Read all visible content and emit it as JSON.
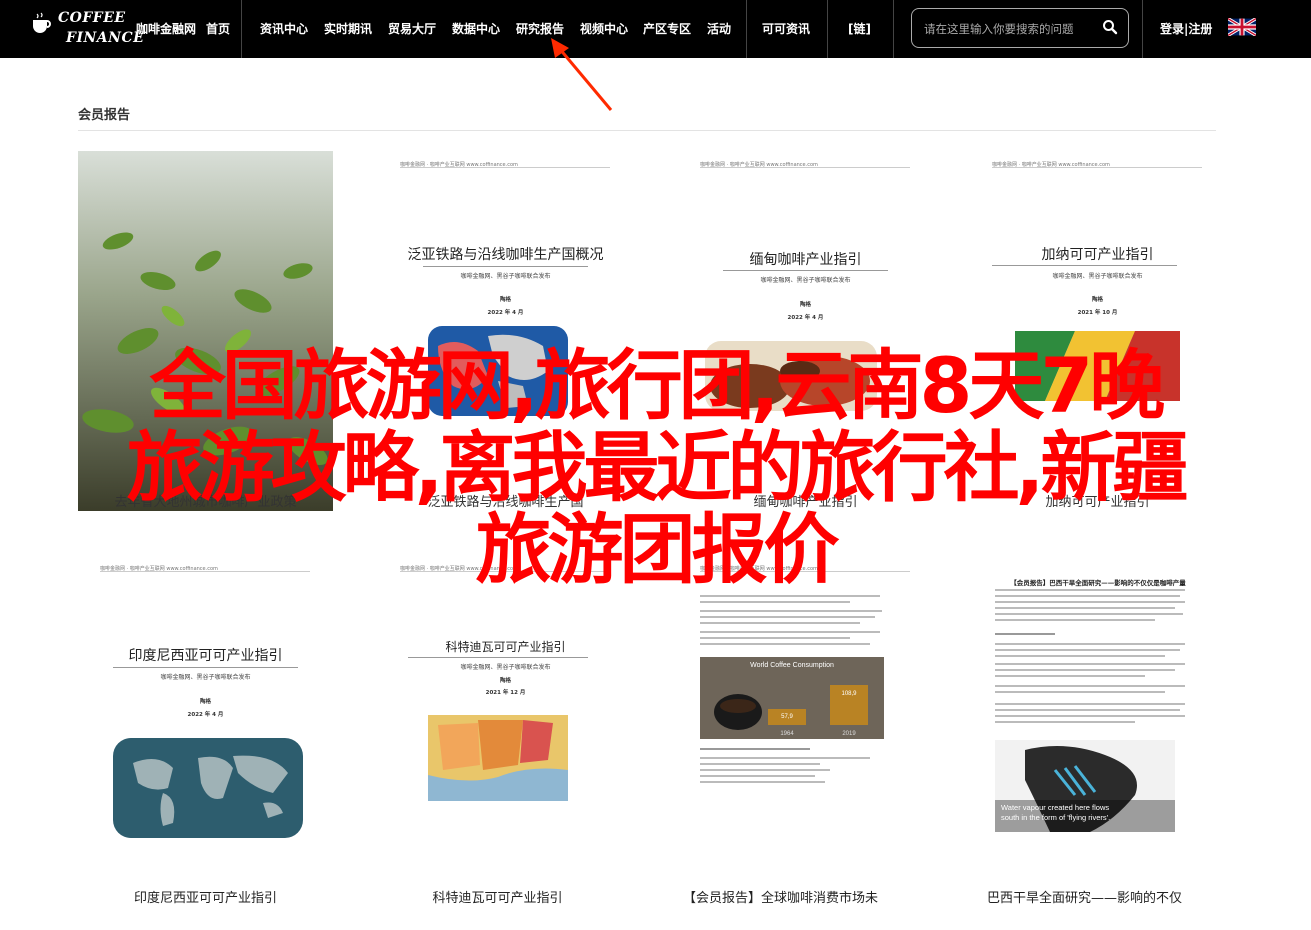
{
  "nav": {
    "logo_line1": "COFFEE",
    "logo_line2": "FINANCE",
    "items": [
      "咖啡金融网",
      "首页",
      "资讯中心",
      "实时期讯",
      "贸易大厅",
      "数据中心",
      "研究报告",
      "视频中心",
      "产区专区",
      "活动",
      "可可资讯",
      "[链]"
    ],
    "search_placeholder": "请在这里输入你要搜索的问题",
    "login": "登录|注册"
  },
  "section": {
    "title": "会员报告"
  },
  "cards": [
    {
      "doc_title": "",
      "caption": ""
    },
    {
      "doc_title": "泛亚铁路与沿线咖啡生产国概况",
      "doc_sub": "咖啡金融网、黑谷子咖啡联合发布",
      "doc_small1": "陶格",
      "doc_small2": "2022 年 4 月",
      "doc_header": "咖啡金融网 · 咖啡产业互联网 www.coffinance.com",
      "caption": ""
    },
    {
      "doc_title": "缅甸咖啡产业指引",
      "doc_sub": "咖啡金融网、黑谷子咖啡联合发布",
      "doc_small1": "陶格",
      "doc_small2": "2022 年 4 月",
      "doc_header": "咖啡金融网 · 咖啡产业互联网 www.coffinance.com",
      "caption": ""
    },
    {
      "doc_title": "加纳可可产业指引",
      "doc_sub": "咖啡金融网、黑谷子咖啡联合发布",
      "doc_small1": "陶格",
      "doc_small2": "2021 年 10 月",
      "doc_header": "咖啡金融网 · 咖啡产业互联网 www.coffinance.com",
      "caption": ""
    },
    {
      "doc_title": "印度尼西亚可可产业指引",
      "doc_sub": "咖啡金融网、黑谷子咖啡联合发布",
      "doc_small1": "陶格",
      "doc_small2": "2022 年 4 月",
      "doc_header": "咖啡金融网 · 咖啡产业互联网 www.coffinance.com",
      "caption": "印度尼西亚可可产业指引"
    },
    {
      "doc_title": "科特迪瓦可可产业指引",
      "doc_sub": "咖啡金融网、黑谷子咖啡联合发布",
      "doc_small1": "陶格",
      "doc_small2": "2021 年 12 月",
      "doc_header": "咖啡金融网 · 咖啡产业互联网 www.coffinance.com",
      "caption": "科特迪瓦可可产业指引"
    },
    {
      "doc_title": "",
      "chart_title": "World Coffee Consumption",
      "chart_v1": "57,9",
      "chart_v2": "108,9",
      "chart_y1": "1964",
      "chart_y2": "2019",
      "doc_header": "咖啡金融网 · 咖啡产业互联网 www.coffinance.com",
      "caption": "【会员报告】全球咖啡消费市场未"
    },
    {
      "doc_title": "【会员报告】巴西干旱全面研究——影响的不仅仅是咖啡产量",
      "map_caption1": "Water vapour created here flows",
      "map_caption2": "south in the form of 'flying rivers'.",
      "caption": "巴西干旱全面研究——影响的不仅"
    }
  ],
  "bottom_captions_row1": [
    "去年省大地州城市咖啡产业政策",
    "泛亚铁路与沿线咖啡生产国",
    "缅甸咖啡产业指引",
    "加纳可可产业指引"
  ],
  "overlay": {
    "line1": "全国旅游网,旅行团,云南8天7晚",
    "line2": "旅游攻略,离我最近的旅行社,新疆",
    "line3": "旅游团报价"
  },
  "colors": {
    "nav_bg": "#000000",
    "overlay_text": "#ff0000",
    "annotation_arrow": "#ff2a00"
  }
}
